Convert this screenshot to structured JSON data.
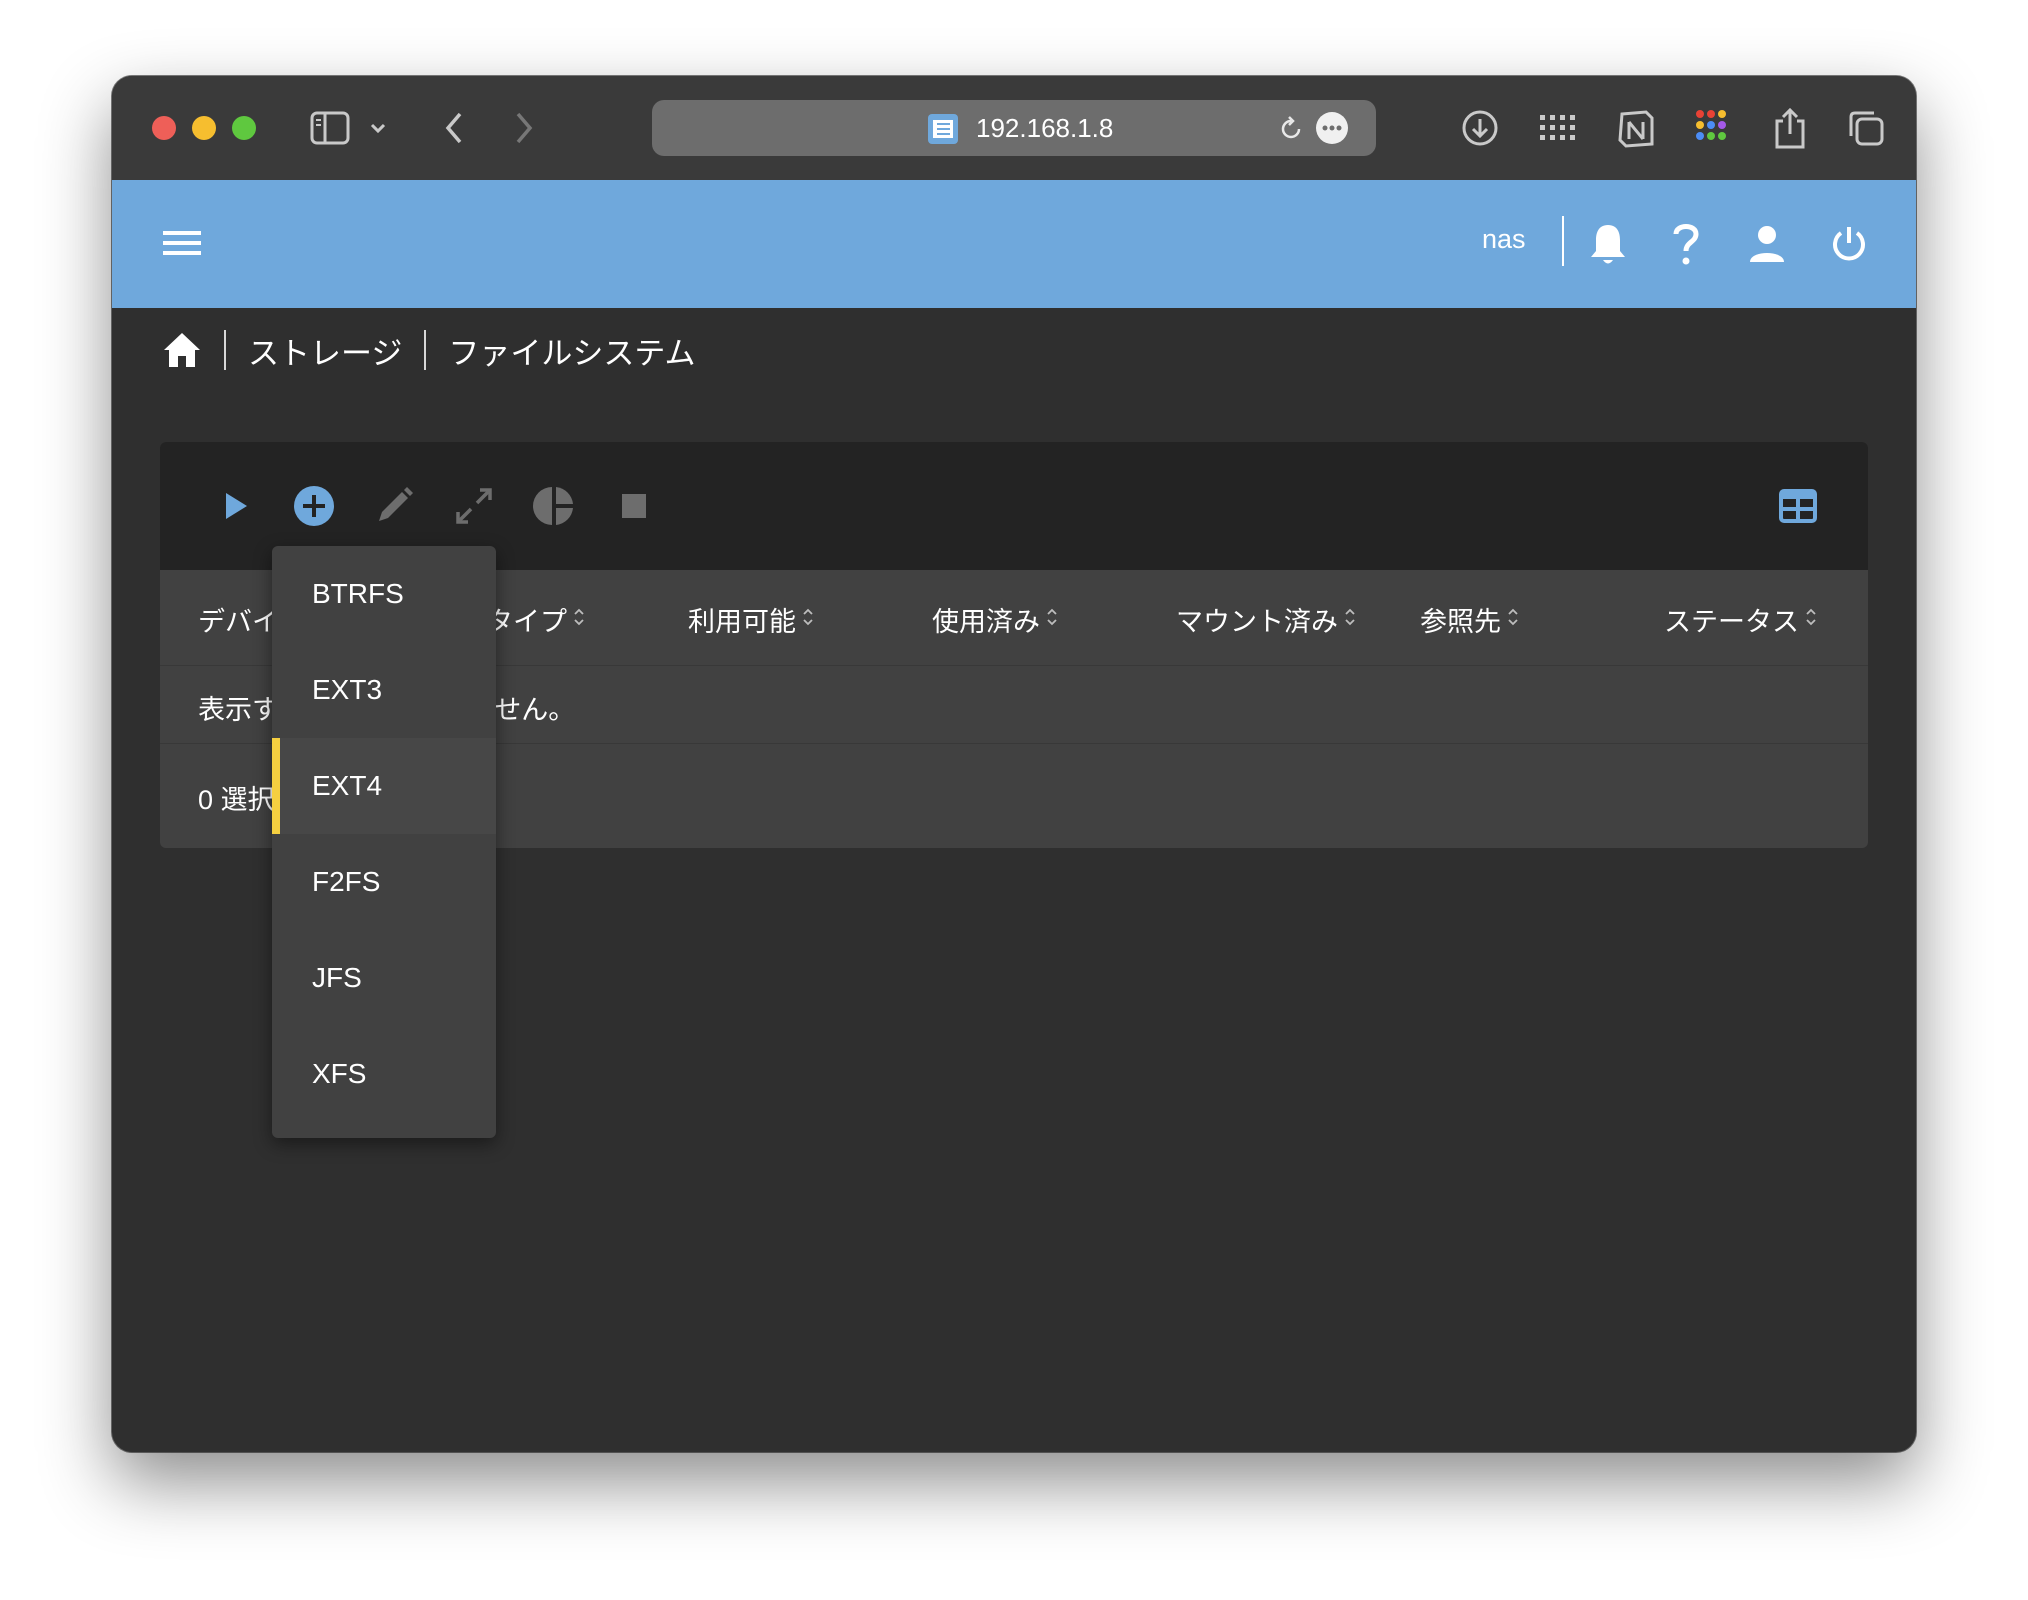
{
  "browser": {
    "url": "192.168.1.8"
  },
  "appbar": {
    "user": "nas"
  },
  "breadcrumb": {
    "items": [
      "ストレージ",
      "ファイルシステム"
    ]
  },
  "table": {
    "columns": [
      "デバイス",
      "タイプ",
      "利用可能",
      "使用済み",
      "マウント済み",
      "参照先",
      "ステータス"
    ],
    "empty_message": "表示するデータがありません。",
    "footer": "0 選択済"
  },
  "menu": {
    "items": [
      {
        "label": "BTRFS",
        "active": false
      },
      {
        "label": "EXT3",
        "active": false
      },
      {
        "label": "EXT4",
        "active": true
      },
      {
        "label": "F2FS",
        "active": false
      },
      {
        "label": "JFS",
        "active": false
      },
      {
        "label": "XFS",
        "active": false
      }
    ]
  },
  "colors": {
    "accent": "#6fa8dc",
    "selection": "#f5cf40",
    "panel": "#414141",
    "toolbar": "#232323"
  }
}
